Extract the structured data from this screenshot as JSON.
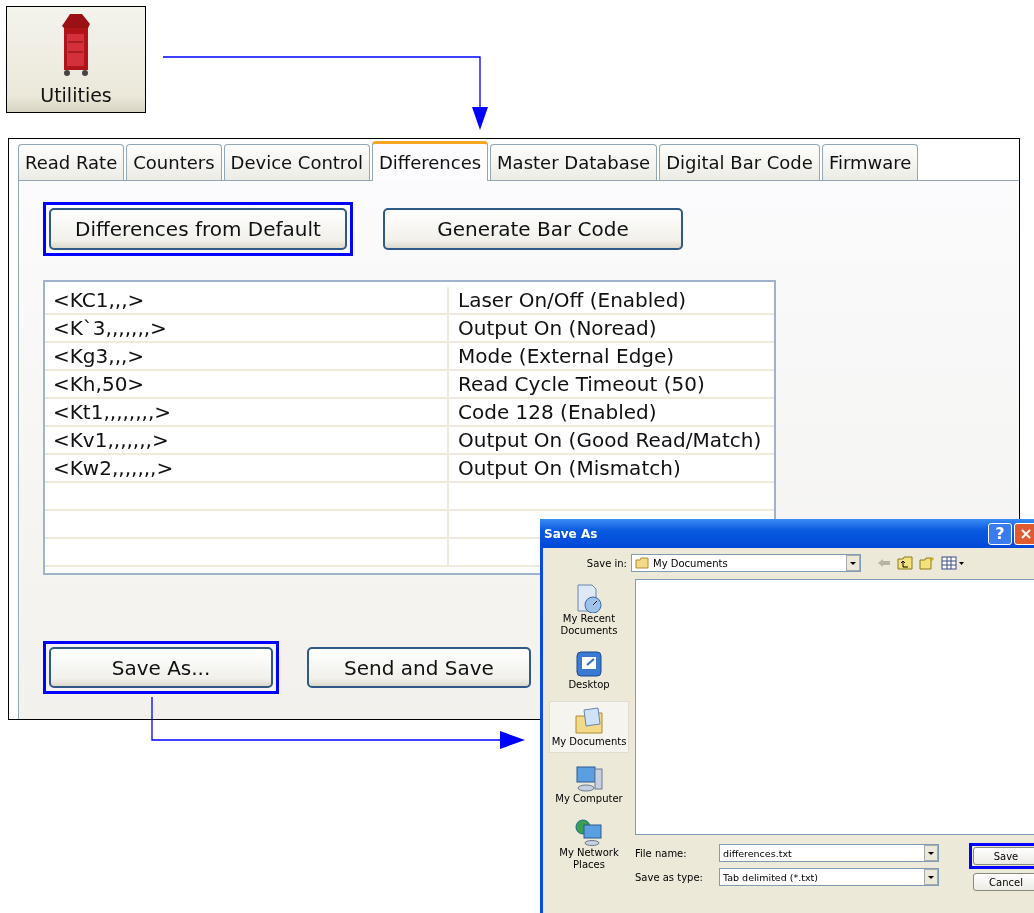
{
  "utilities_button": {
    "label": "Utilities"
  },
  "tabs": [
    {
      "label": "Read Rate",
      "selected": false
    },
    {
      "label": "Counters",
      "selected": false
    },
    {
      "label": "Device Control",
      "selected": false
    },
    {
      "label": "Differences",
      "selected": true
    },
    {
      "label": "Master Database",
      "selected": false
    },
    {
      "label": "Digital Bar Code",
      "selected": false
    },
    {
      "label": "Firmware",
      "selected": false
    }
  ],
  "top_buttons": [
    {
      "label": "Differences from Default",
      "highlighted": true
    },
    {
      "label": "Generate Bar Code",
      "highlighted": false
    }
  ],
  "differences": [
    {
      "command": "<KC1,,,>",
      "description": "Laser On/Off (Enabled)"
    },
    {
      "command": "<K`3,,,,,,,>",
      "description": "Output On (Noread)"
    },
    {
      "command": "<Kg3,,,>",
      "description": "Mode (External Edge)"
    },
    {
      "command": "<Kh,50>",
      "description": "Read Cycle Timeout (50)"
    },
    {
      "command": "<Kt1,,,,,,,,>",
      "description": "Code 128 (Enabled)"
    },
    {
      "command": "<Kv1,,,,,,,>",
      "description": "Output On (Good Read/Match)"
    },
    {
      "command": "<Kw2,,,,,,,>",
      "description": "Output On (Mismatch)"
    }
  ],
  "bottom_buttons": [
    {
      "label": "Save As...",
      "highlighted": true
    },
    {
      "label": "Send and Save",
      "highlighted": false
    }
  ],
  "save_dialog": {
    "title": "Save As",
    "help": "?",
    "save_in_label": "Save in:",
    "save_in": "My Documents",
    "places": [
      {
        "label": "My Recent Documents",
        "kind": "recent",
        "selected": false
      },
      {
        "label": "Desktop",
        "kind": "desktop",
        "selected": false
      },
      {
        "label": "My Documents",
        "kind": "documents",
        "selected": true
      },
      {
        "label": "My Computer",
        "kind": "computer",
        "selected": false
      },
      {
        "label": "My Network Places",
        "kind": "network",
        "selected": false
      }
    ],
    "file_name_label": "File name:",
    "file_name": "differences.txt",
    "type_label": "Save as type:",
    "type": "Tab delimited (*.txt)",
    "buttons": [
      {
        "label": "Save",
        "highlighted": true
      },
      {
        "label": "Cancel",
        "highlighted": false
      }
    ]
  }
}
